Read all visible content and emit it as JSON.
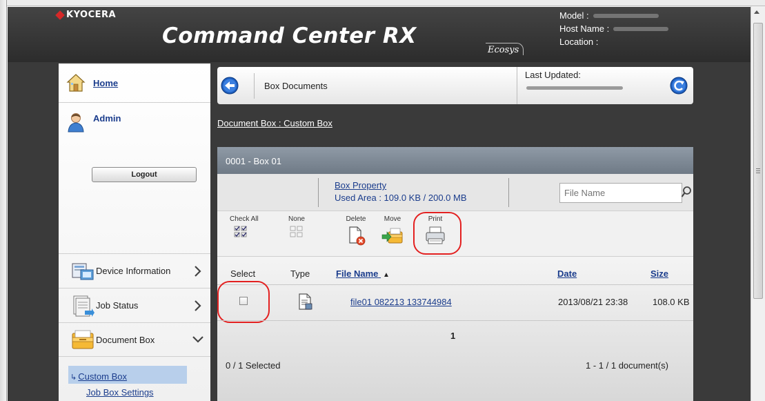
{
  "header": {
    "brand": "KYOCERA",
    "product_title": "Command Center RX",
    "eco_logo": "Ecosys",
    "model_label": "Model :",
    "host_label": "Host Name :",
    "location_label": "Location :"
  },
  "sidebar": {
    "home_label": "Home",
    "admin_label": "Admin",
    "logout_label": "Logout",
    "menu": [
      {
        "label": "Device Information",
        "icon": "device-info-icon"
      },
      {
        "label": "Job Status",
        "icon": "job-status-icon"
      },
      {
        "label": "Document Box",
        "icon": "document-box-icon"
      }
    ],
    "submenu": [
      {
        "label": "Custom Box",
        "selected": true
      },
      {
        "label": "Job Box Settings",
        "selected": false
      }
    ]
  },
  "topbar": {
    "title": "Box Documents",
    "last_updated_label": "Last Updated:"
  },
  "breadcrumb": "Document Box : Custom Box",
  "box": {
    "header": "0001 - Box 01",
    "property_link": "Box Property",
    "used_area": "Used Area : 109.0 KB / 200.0 MB",
    "search_placeholder": "File Name"
  },
  "toolbar": {
    "check_all": "Check All",
    "none": "None",
    "delete": "Delete",
    "move": "Move",
    "print": "Print"
  },
  "table": {
    "columns": {
      "select": "Select",
      "type": "Type",
      "file_name": "File Name",
      "date": "Date",
      "size": "Size"
    },
    "rows": [
      {
        "file_name": "file01 082213 133744984",
        "date": "2013/08/21 23:38",
        "size": "108.0 KB",
        "checked": false
      }
    ]
  },
  "pagination": {
    "page": "1",
    "selected": "0 / 1 Selected",
    "documents": "1 - 1 / 1 document(s)"
  },
  "colors": {
    "link": "#1a3c8c",
    "highlight": "#e32020",
    "header_bg": "#3a3a3a",
    "selected_sub_bg": "#b8cfeb"
  }
}
